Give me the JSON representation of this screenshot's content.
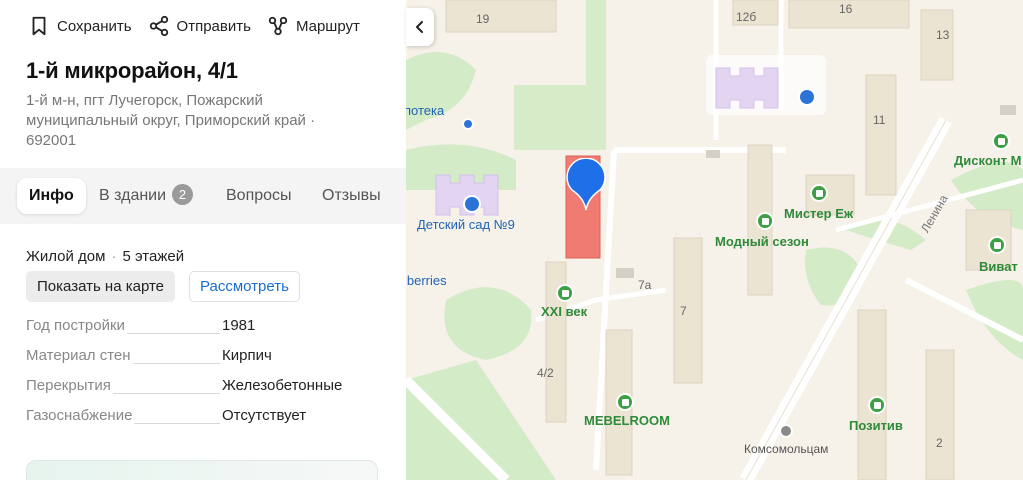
{
  "actions": {
    "save": "Сохранить",
    "share": "Отправить",
    "route": "Маршрут"
  },
  "place": {
    "title": "1-й микрорайон, 4/1",
    "address": "1-й м-н, пгт Лучегорск, Пожарский муниципальный округ, Приморский край · 692001"
  },
  "tabs": {
    "info": "Инфо",
    "inside": "В здании",
    "inside_count": "2",
    "questions": "Вопросы",
    "reviews": "Отзывы"
  },
  "building": {
    "type": "Жилой дом",
    "floors": "5 этажей",
    "show_on_map": "Показать на карте",
    "view": "Рассмотреть"
  },
  "properties": [
    {
      "label": "Год постройки",
      "value": "1981"
    },
    {
      "label": "Материал стен",
      "value": "Кирпич"
    },
    {
      "label": "Перекрытия",
      "value": "Железобетонные"
    },
    {
      "label": "Газоснабжение",
      "value": "Отсутствует"
    }
  ],
  "map": {
    "house_numbers": [
      "19",
      "12б",
      "16",
      "13",
      "11",
      "7а",
      "7",
      "4/2",
      "2"
    ],
    "pois": {
      "apteka": "потека",
      "diskont": "Дисконт М",
      "kindergarten": "Детский сад №9",
      "mister_ezh": "Мистер Еж",
      "modny_sezon": "Модный сезон",
      "berries": "lberries",
      "viva": "Виват",
      "xxi": "XXI век",
      "mebelroom": "MEBELROOM",
      "pozitiv": "Позитив",
      "komsomoltsam": "Комсомольцам"
    },
    "street": "Ленина",
    "colors": {
      "marker": "#1e6fe8",
      "selected_building": "#ef7b73",
      "green": "#2f8a3a"
    }
  }
}
